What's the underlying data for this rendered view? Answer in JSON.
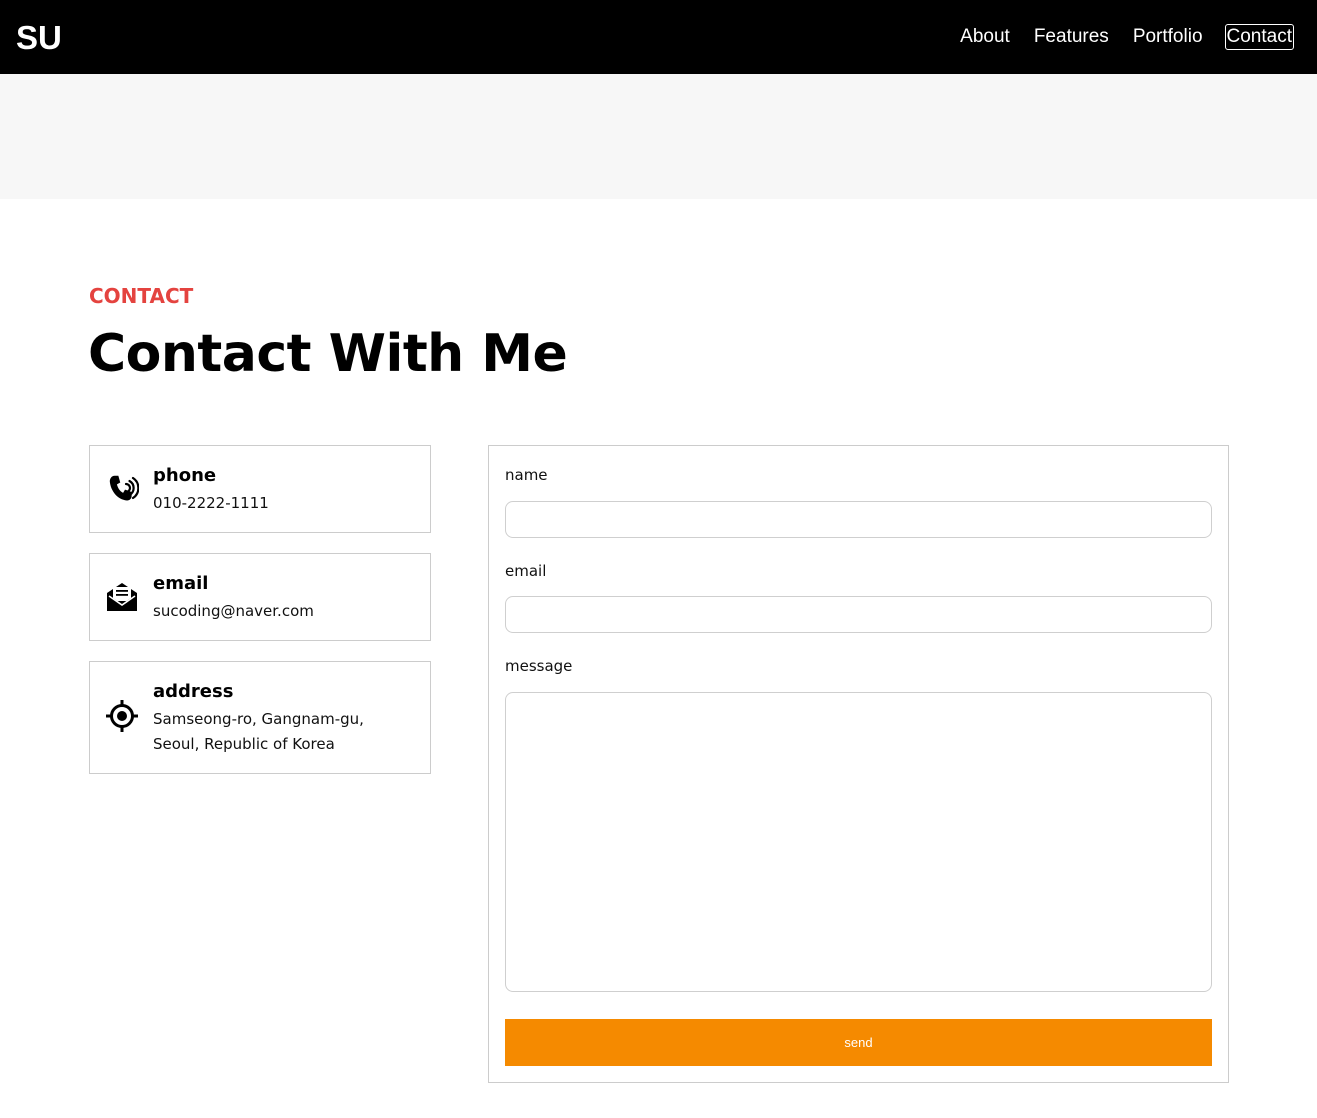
{
  "header": {
    "logo": "SU",
    "nav": [
      {
        "label": "About"
      },
      {
        "label": "Features"
      },
      {
        "label": "Portfolio"
      },
      {
        "label": "Contact"
      }
    ]
  },
  "section": {
    "eyebrow": "CONTACT",
    "title": "Contact With Me"
  },
  "info": [
    {
      "icon": "phone-icon",
      "title": "phone",
      "lines": [
        "010-2222-1111"
      ]
    },
    {
      "icon": "email-icon",
      "title": "email",
      "lines": [
        "sucoding@naver.com"
      ]
    },
    {
      "icon": "location-icon",
      "title": "address",
      "lines": [
        "Samseong-ro, Gangnam-gu,",
        "Seoul, Republic of Korea"
      ]
    }
  ],
  "form": {
    "name_label": "name",
    "name_value": "",
    "email_label": "email",
    "email_value": "",
    "message_label": "message",
    "message_value": "",
    "send_label": "send"
  },
  "colors": {
    "accent": "#e4433f",
    "button": "#f58a00",
    "header_bg": "#000000",
    "banner_bg": "#f7f7f7"
  }
}
